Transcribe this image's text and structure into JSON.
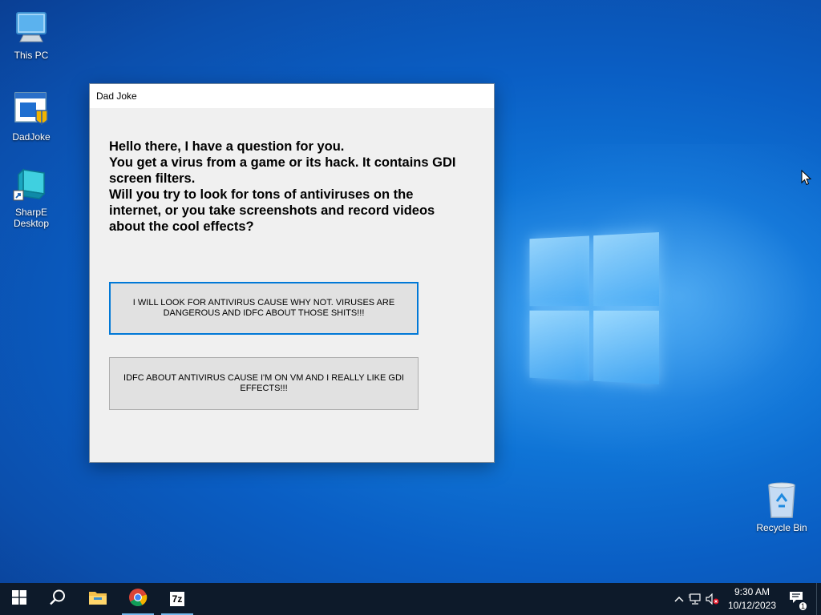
{
  "desktop": {
    "icons": [
      {
        "label": "This PC",
        "icon": "this-pc-icon"
      },
      {
        "label": "DadJoke",
        "icon": "dadjoke-app-icon"
      },
      {
        "label": "SharpE Desktop",
        "icon": "sharpe-desktop-icon"
      },
      {
        "label": "Recycle Bin",
        "icon": "recycle-bin-icon"
      }
    ]
  },
  "window": {
    "title": "Dad Joke",
    "question": "Hello there, I have a question for you.\nYou get a virus from a game or its hack. It contains GDI screen filters.\nWill you try to look for tons of antiviruses on the internet, or you take screenshots and record videos about the cool effects?",
    "button1_label": "I WILL LOOK FOR ANTIVIRUS CAUSE WHY NOT. VIRUSES ARE DANGEROUS AND IDFC ABOUT THOSE SHITS!!!",
    "button2_label": "IDFC ABOUT ANTIVIRUS CAUSE I'M ON VM AND I REALLY LIKE GDI EFFECTS!!!"
  },
  "taskbar": {
    "apps": [
      "start-icon",
      "search-icon",
      "file-explorer-icon",
      "chrome-icon",
      "7zip-icon"
    ],
    "time": "9:30 AM",
    "date": "10/12/2023",
    "notification_count": "1",
    "app_7zip_label": "7z"
  },
  "colors": {
    "accent": "#0078d7",
    "taskbar": "#0d1a2a",
    "window_bg": "#f0f0f0"
  }
}
